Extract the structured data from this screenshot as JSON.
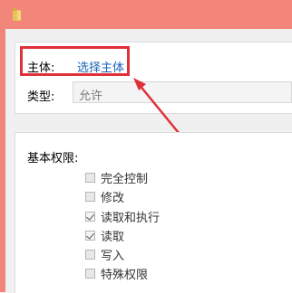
{
  "title_bar": {
    "folder_icon": "folder-icon",
    "color": "#f2867a"
  },
  "principal": {
    "label": "主体:",
    "link_text": "选择主体",
    "link_color": "#1a62b8"
  },
  "type": {
    "label": "类型:",
    "value": "允许"
  },
  "permissions": {
    "heading": "基本权限:",
    "items": [
      {
        "label": "完全控制",
        "checked": false
      },
      {
        "label": "修改",
        "checked": false
      },
      {
        "label": "读取和执行",
        "checked": true
      },
      {
        "label": "读取",
        "checked": true
      },
      {
        "label": "写入",
        "checked": false
      },
      {
        "label": "特殊权限",
        "checked": false
      }
    ]
  },
  "annotation": {
    "highlight_color": "#e0303a"
  }
}
